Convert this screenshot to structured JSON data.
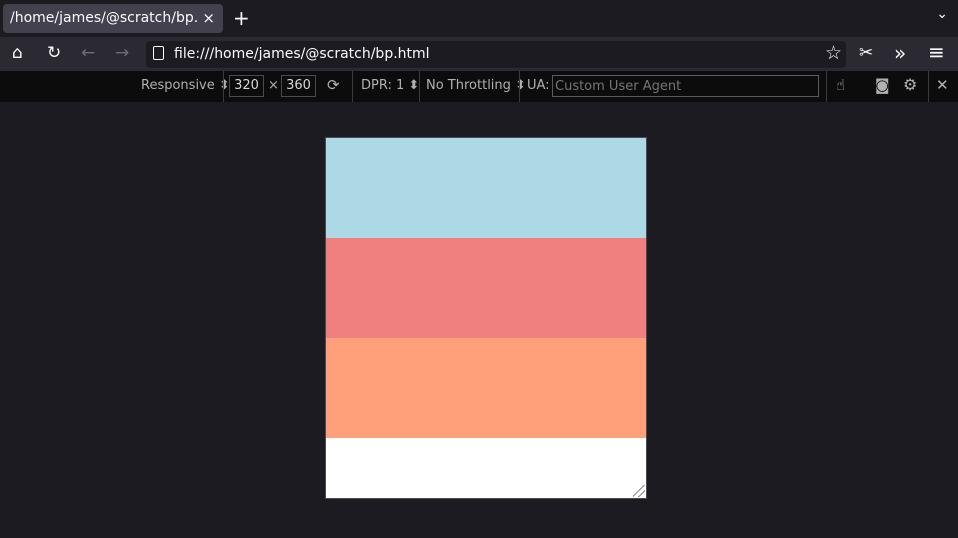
{
  "tab": {
    "title": "/home/james/@scratch/bp.html",
    "close": "×",
    "new_tab": "+",
    "list_all": "⌄"
  },
  "nav": {
    "home": "⌂",
    "reload": "↻",
    "back": "←",
    "forward": "→",
    "url": "file:///home/james/@scratch/bp.html",
    "bookmark": "☆",
    "screenshot": "✂",
    "overflow": "»",
    "menu": "≡"
  },
  "rdm": {
    "device": "Responsive",
    "width": "320",
    "times": "×",
    "height": "360",
    "rotate": "⟳",
    "dpr": "DPR: 1",
    "throttling": "No Throttling",
    "ua_label": "UA:",
    "ua_placeholder": "Custom User Agent",
    "touch": "☝",
    "camera": "◙",
    "settings": "⚙",
    "close": "✕"
  },
  "viewport": {
    "blocks": [
      {
        "color": "#add8e6"
      },
      {
        "color": "#f08080"
      },
      {
        "color": "#ffa07a"
      },
      {
        "color": "#ffffff"
      }
    ]
  }
}
